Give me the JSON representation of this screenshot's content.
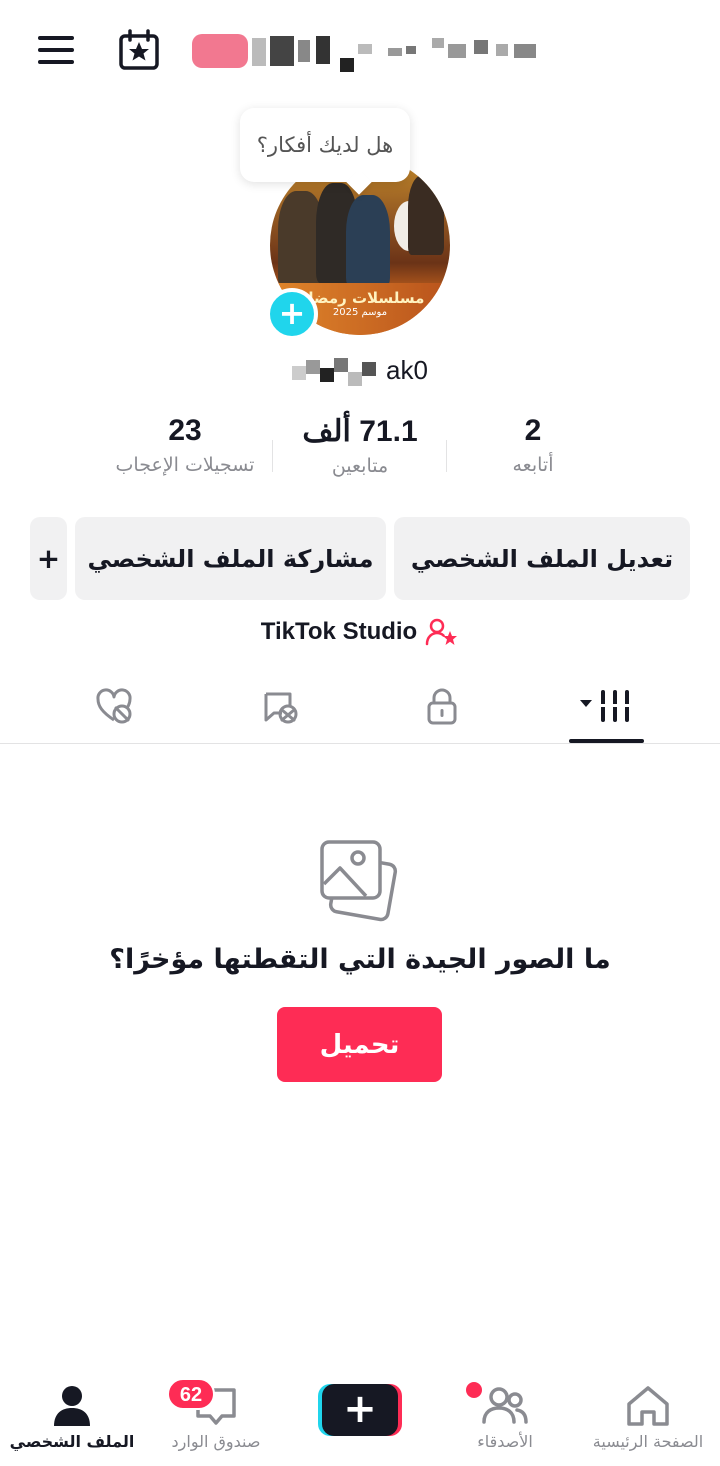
{
  "header": {
    "menu_icon": "hamburger-icon",
    "calendar_icon": "calendar-star-icon"
  },
  "profile": {
    "tooltip": "هل لديك أفكار؟",
    "avatar_banner": "مسلسلات رمضان",
    "avatar_banner_sub": "موسم 2025",
    "handle_visible": "ak0",
    "add_avatar": "+"
  },
  "stats": [
    {
      "number": "2",
      "label": "أتابعه"
    },
    {
      "number": "71.1 ألف",
      "label": "متابعين"
    },
    {
      "number": "23",
      "label": "تسجيلات الإعجاب"
    }
  ],
  "actions": {
    "edit_profile": "تعديل الملف الشخصي",
    "share_profile": "مشاركة الملف الشخصي",
    "add": "+"
  },
  "studio": {
    "label": "TikTok Studio",
    "icon": "person-star-icon"
  },
  "tabs": [
    {
      "name": "videos",
      "icon": "grid-bars-icon",
      "active": true
    },
    {
      "name": "private",
      "icon": "lock-icon"
    },
    {
      "name": "reposts",
      "icon": "repost-icon"
    },
    {
      "name": "liked",
      "icon": "heart-hidden-icon"
    }
  ],
  "empty": {
    "title": "ما الصور الجيدة التي التقطتها مؤخرًا؟",
    "upload": "تحميل"
  },
  "nav": {
    "home": "الصفحة الرئيسية",
    "friends": "الأصدقاء",
    "create": "+",
    "inbox": "صندوق الوارد",
    "inbox_badge": "62",
    "profile": "الملف الشخصي"
  },
  "colors": {
    "accent": "#fe2c55",
    "cyan": "#20d5ec",
    "text": "#161823",
    "muted": "#8a8b91"
  }
}
